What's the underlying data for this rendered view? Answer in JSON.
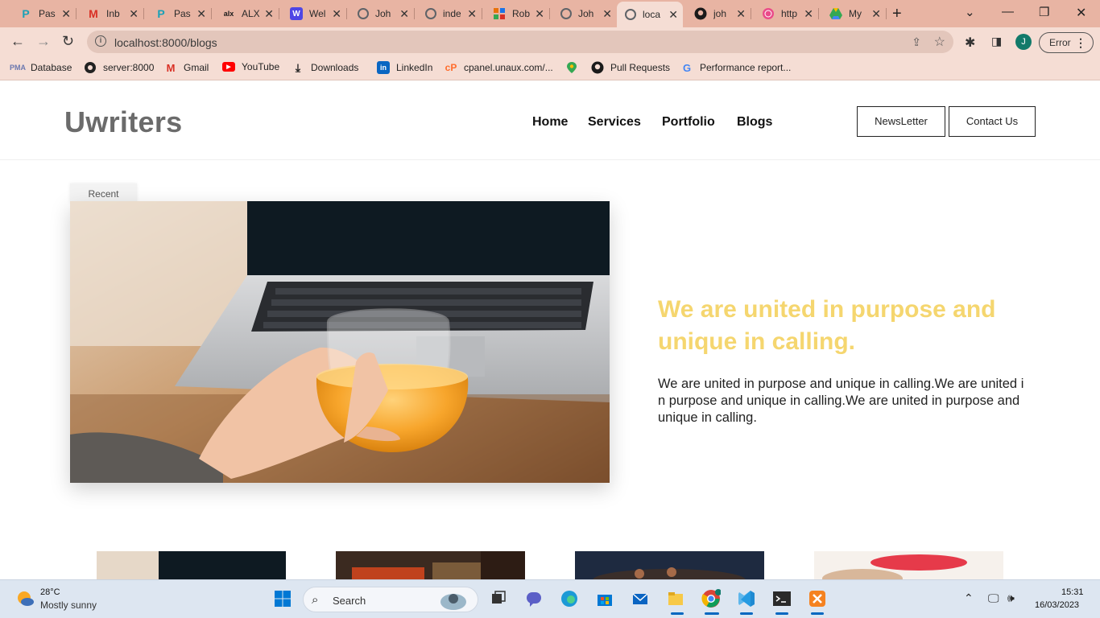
{
  "browser": {
    "tabs": [
      {
        "label": "Pas",
        "icon": "p-icon",
        "color": "#1ba1b7"
      },
      {
        "label": "Inb",
        "icon": "gmail-icon",
        "color": "#d93025"
      },
      {
        "label": "Pas",
        "icon": "p-icon",
        "color": "#1ba1b7"
      },
      {
        "label": "ALX",
        "icon": "alx-icon",
        "color": "#1a1a1a"
      },
      {
        "label": "Wel",
        "icon": "w-icon",
        "color": "#4f46e5"
      },
      {
        "label": "Joh",
        "icon": "globe-icon",
        "color": "#5f6368"
      },
      {
        "label": "inde",
        "icon": "globe-icon",
        "color": "#5f6368"
      },
      {
        "label": "Rob",
        "icon": "grid-icon",
        "color": "#e8710a"
      },
      {
        "label": "Joh",
        "icon": "globe-icon",
        "color": "#5f6368"
      },
      {
        "label": "loca",
        "icon": "globe-icon",
        "color": "#5f6368"
      },
      {
        "label": "joh",
        "icon": "github-icon",
        "color": "#1a1a1a"
      },
      {
        "label": "http",
        "icon": "dribbble-icon",
        "color": "#ea4c89"
      },
      {
        "label": "My",
        "icon": "drive-icon",
        "color": "#34a853"
      }
    ],
    "active_tab_index": 9,
    "url": "localhost:8000/blogs",
    "profile_initial": "J",
    "error_label": "Error",
    "bookmarks": [
      {
        "label": "Database",
        "icon": "phpmyadmin-icon"
      },
      {
        "label": "server:8000",
        "icon": "globe-icon"
      },
      {
        "label": "Gmail",
        "icon": "gmail-icon"
      },
      {
        "label": "YouTube",
        "icon": "youtube-icon"
      },
      {
        "label": "Downloads",
        "icon": "download-icon"
      },
      {
        "label": "LinkedIn",
        "icon": "linkedin-icon"
      },
      {
        "label": "cpanel.unaux.com/...",
        "icon": "cpanel-icon"
      },
      {
        "label": "",
        "icon": "maps-icon"
      },
      {
        "label": "Pull Requests",
        "icon": "github-icon"
      },
      {
        "label": "Performance report...",
        "icon": "google-icon"
      }
    ]
  },
  "site": {
    "logo": "Uwriters",
    "nav": [
      "Home",
      "Services",
      "Portfolio",
      "Blogs"
    ],
    "newsletter_label": "NewsLetter",
    "contact_label": "Contact Us",
    "recent_tag": "Recent",
    "hero_title": "We are united in purpose and unique in calling.",
    "hero_text": "We are united in purpose and unique in calling.We are united in purpose and unique in calling.We are united in purpose and unique in calling.",
    "title_color": "#f5d66f"
  },
  "taskbar": {
    "temperature": "28°C",
    "condition": "Mostly sunny",
    "search_placeholder": "Search",
    "time": "15:31",
    "date": "16/03/2023"
  }
}
